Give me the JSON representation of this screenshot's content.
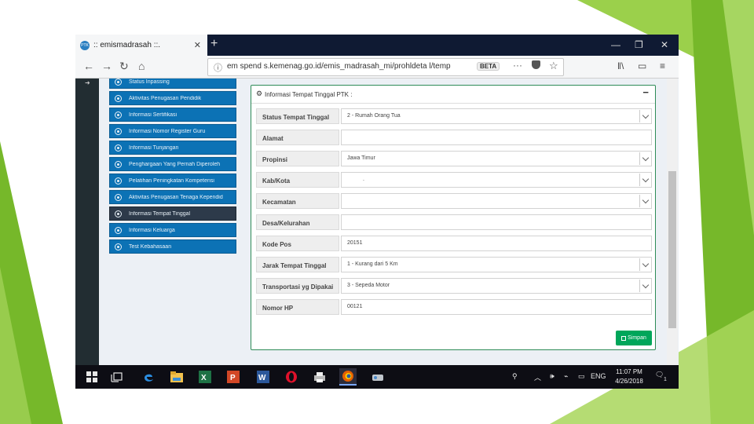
{
  "colors": {
    "green_accent": "#7ab41e",
    "sidebar_blue": "#0c72b5",
    "active_item": "#2d3a4a",
    "panel_border": "#2e8b57",
    "save_green": "#00a65a",
    "taskbar": "#0d0d14"
  },
  "browser": {
    "tab_title": ":: emismadrasah ::.",
    "url": "em spend s.kemenag.go.id/emis_madrasah_mi/prohldeta l/temp",
    "zoom_badge": "BETA",
    "icons": [
      "info-icon",
      "back-icon",
      "forward-icon",
      "home-icon",
      "new-tab-icon",
      "minimize-icon",
      "maximize-icon",
      "close-icon",
      "more-icon",
      "pocket-icon",
      "bookmark-star-icon",
      "library-icon",
      "sidebar-icon",
      "menu-icon"
    ]
  },
  "sidebar": {
    "items": [
      {
        "label": "Status Inpassing",
        "active": false
      },
      {
        "label": "Aktivitas Penugasan Pendidik",
        "active": false
      },
      {
        "label": "Informasi Sertifikasi",
        "active": false
      },
      {
        "label": "Informasi Nomor Register Guru",
        "active": false
      },
      {
        "label": "Informasi Tunjangan",
        "active": false
      },
      {
        "label": "Penghargaan Yang Pernah Diperoleh",
        "active": false
      },
      {
        "label": "Pelatihan Peningkatan Kompetensi",
        "active": false
      },
      {
        "label": "Aktivitas Penugasan Tenaga Kependid",
        "active": false
      },
      {
        "label": "Informasi Tempat Tinggal",
        "active": true
      },
      {
        "label": "Informasi Keluarga",
        "active": false
      },
      {
        "label": "Test Kebahasaan",
        "active": false
      }
    ]
  },
  "panel": {
    "title": "Informasi Tempat Tinggal PTK :",
    "collapse_label": "−",
    "fields": [
      {
        "label": "Status Tempat Tinggal",
        "value": "2 - Rumah Orang Tua",
        "dropdown": true
      },
      {
        "label": "Alamat",
        "value": "",
        "dropdown": false
      },
      {
        "label": "Propinsi",
        "value": "Jawa Timur",
        "dropdown": true
      },
      {
        "label": "Kab/Kota",
        "value": ".",
        "dropdown": true
      },
      {
        "label": "Kecamatan",
        "value": "",
        "dropdown": true
      },
      {
        "label": "Desa/Kelurahan",
        "value": "",
        "dropdown": false
      },
      {
        "label": "Kode Pos",
        "value": "20151",
        "dropdown": false
      },
      {
        "label": "Jarak Tempat Tinggal",
        "value": "1 - Kurang dari 5 Km",
        "dropdown": true
      },
      {
        "label": "Transportasi yg Dipakai",
        "value": "3 - Sepeda Motor",
        "dropdown": true
      },
      {
        "label": "Nomor HP",
        "value": "00121",
        "dropdown": false
      }
    ],
    "save_label": "Simpan"
  },
  "taskbar": {
    "apps": [
      "windows-start-icon",
      "task-view-icon",
      "edge-icon",
      "file-explorer-icon",
      "excel-icon",
      "powerpoint-icon",
      "word-icon",
      "opera-icon",
      "printer-app-icon",
      "firefox-icon",
      "app-icon"
    ],
    "language": "ENG",
    "time": "11:07 PM",
    "date": "4/26/2018",
    "notification_count": "1"
  }
}
